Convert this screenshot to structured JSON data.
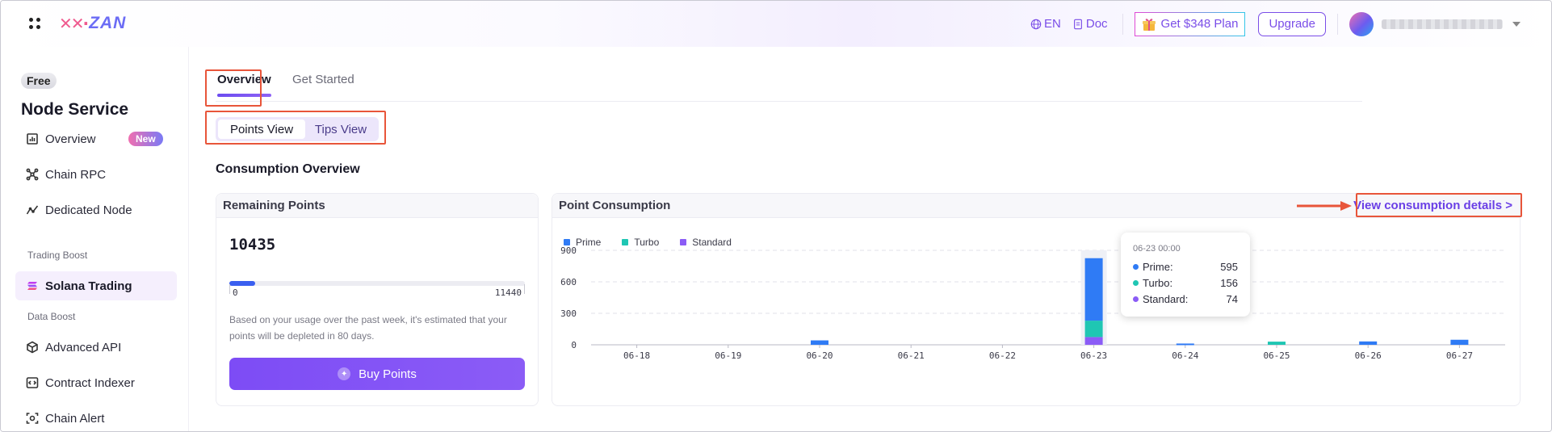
{
  "header": {
    "logo_text": "ZAN",
    "language": "EN",
    "doc": "Doc",
    "plan_offer": "Get $348 Plan",
    "upgrade": "Upgrade"
  },
  "sidebar": {
    "plan_badge": "Free",
    "title": "Node Service",
    "items": [
      {
        "label": "Overview",
        "badge": "New"
      },
      {
        "label": "Chain RPC"
      },
      {
        "label": "Dedicated Node"
      },
      {
        "label": "Solana Trading"
      },
      {
        "label": "Advanced API"
      },
      {
        "label": "Contract Indexer"
      },
      {
        "label": "Chain Alert"
      }
    ],
    "sections": {
      "trading": "Trading Boost",
      "data": "Data Boost"
    }
  },
  "main": {
    "tabs": [
      "Overview",
      "Get Started"
    ],
    "views": [
      "Points View",
      "Tips View"
    ],
    "section_title": "Consumption Overview",
    "remaining": {
      "title": "Remaining Points",
      "value": "10435",
      "min": "0",
      "max": "11440",
      "used_fraction": 0.088,
      "estimate": "Based on your usage over the past week, it's estimated that your points will be depleted in 80 days.",
      "buy_label": "Buy Points"
    },
    "consumption": {
      "title": "Point Consumption",
      "details_link": "View consumption details >"
    }
  },
  "chart_data": {
    "type": "bar",
    "stacked": true,
    "categories": [
      "06-18",
      "06-19",
      "06-20",
      "06-21",
      "06-22",
      "06-23",
      "06-24",
      "06-25",
      "06-26",
      "06-27"
    ],
    "series": [
      {
        "name": "Prime",
        "color": "#2f7bf5",
        "values": [
          0,
          0,
          42,
          0,
          0,
          595,
          12,
          0,
          32,
          48
        ]
      },
      {
        "name": "Turbo",
        "color": "#1fc6b3",
        "values": [
          0,
          0,
          0,
          0,
          0,
          156,
          0,
          30,
          0,
          0
        ]
      },
      {
        "name": "Standard",
        "color": "#8b5cf6",
        "values": [
          0,
          0,
          0,
          0,
          0,
          74,
          0,
          0,
          0,
          0
        ]
      }
    ],
    "yticks": [
      0,
      300,
      600,
      900
    ],
    "ylim": [
      0,
      900
    ],
    "legend": "top-left",
    "grid": true,
    "tooltip": {
      "title": "06-23 00:00",
      "rows": [
        {
          "label": "Prime:",
          "value": "595"
        },
        {
          "label": "Turbo:",
          "value": "156"
        },
        {
          "label": "Standard:",
          "value": "74"
        }
      ]
    }
  },
  "colors": {
    "accent": "#7a4de8",
    "highlight": "#e8553a"
  }
}
